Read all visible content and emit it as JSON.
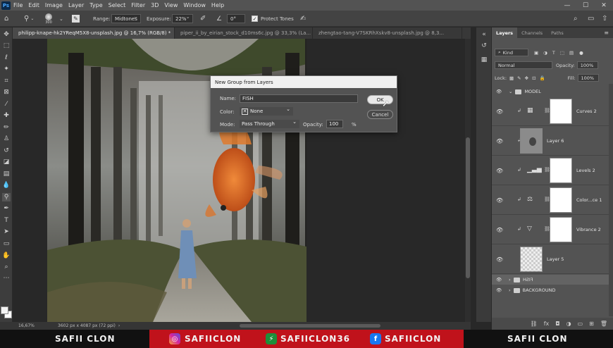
{
  "app": {
    "logo": "Ps"
  },
  "menu": [
    "File",
    "Edit",
    "Image",
    "Layer",
    "Type",
    "Select",
    "Filter",
    "3D",
    "View",
    "Window",
    "Help"
  ],
  "window_controls": {
    "minimize": "—",
    "restore": "☐",
    "close": "✕"
  },
  "options_bar": {
    "brush_size": "300",
    "range_label": "Range:",
    "range_value": "Midtones",
    "exposure_label": "Exposure:",
    "exposure_value": "22%",
    "angle_value": "0°",
    "protect_tones_label": "Protect Tones"
  },
  "tabs": [
    {
      "label": "philipp-knape-hk2YReqM5X8-unsplash.jpg @ 16,7% (RGB/8) *",
      "active": true
    },
    {
      "label": "piper_ii_by_eirian_stock_d10ms6c.jpg @ 33,3% (La...",
      "active": false
    },
    {
      "label": "zhengtao-tang-V7SKRhXskv8-unsplash.jpg @ 8,3...",
      "active": false
    }
  ],
  "status_bar": {
    "zoom": "16,67%",
    "doc_size": "3602 px x 4087 px (72 ppi)"
  },
  "dialog": {
    "title": "New Group from Layers",
    "name_label": "Name:",
    "name_value": "FISH",
    "color_label": "Color:",
    "color_value": "None",
    "mode_label": "Mode:",
    "mode_value": "Pass Through",
    "opacity_label": "Opacity:",
    "opacity_value": "100",
    "opacity_unit": "%",
    "ok_label": "OK",
    "cancel_label": "Cancel"
  },
  "layers_panel": {
    "tabs": [
      "Layers",
      "Channels",
      "Paths"
    ],
    "filter_value": "Kind",
    "blend_mode": "Normal",
    "opacity_label": "Opacity:",
    "opacity_value": "100%",
    "lock_label": "Lock:",
    "fill_label": "Fill:",
    "fill_value": "100%",
    "groups": {
      "model": "MODEL",
      "fish": "FISH",
      "background": "BACKGROUND"
    },
    "layers": {
      "curves": "Curves 2",
      "layer6": "Layer 6",
      "levels": "Levels 2",
      "colorbal": "Color...ce 1",
      "vibrance": "Vibrance 2",
      "layer5": "Layer 5"
    }
  },
  "banner": {
    "left_name": "SAFII CLON",
    "instagram": "SAFIICLON",
    "other": "SAFIICLON36",
    "facebook": "SAFIICLON",
    "right_name": "SAFII CLON"
  }
}
